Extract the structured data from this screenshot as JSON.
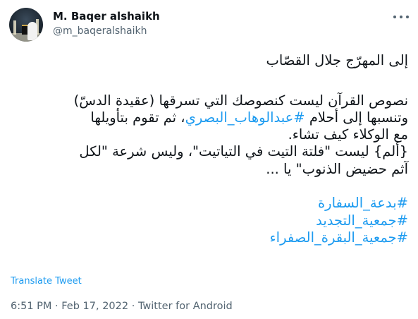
{
  "tweet": {
    "author_name": "M. Baqer alshaikh",
    "author_handle": "@m_baqeralshaikh",
    "lines": [
      "إلى المهرّج جلال القصّاب",
      "نصوص القرآن ليست كنصوصك التي تسرقها (عقيدة الدسّ)",
      "وتنسبها إلى أحلام",
      "#عبدالوهاب_البصري",
      "، ثم تقوم بتأويلها",
      "مع الوكلاء كيف تشاء.",
      "{ألم} ليست \"فلتة التيت في التياتيت\"، وليس شرعة \"لكل",
      "آثم حضيض الذنوب\" يا ..."
    ],
    "hashtags": [
      "#بدعة_السفارة",
      "#جمعية_التجديد",
      "#جمعية_البقرة_الصفراء"
    ],
    "translate_label": "Translate Tweet",
    "timestamp": "6:51 PM · Feb 17, 2022",
    "source": "Twitter for Android",
    "meta_separator": " · "
  },
  "icons": {
    "more": "more-horizontal-icon"
  },
  "colors": {
    "link": "#1d9bf0",
    "secondary_text": "#536471",
    "primary_text": "#0f1419"
  }
}
